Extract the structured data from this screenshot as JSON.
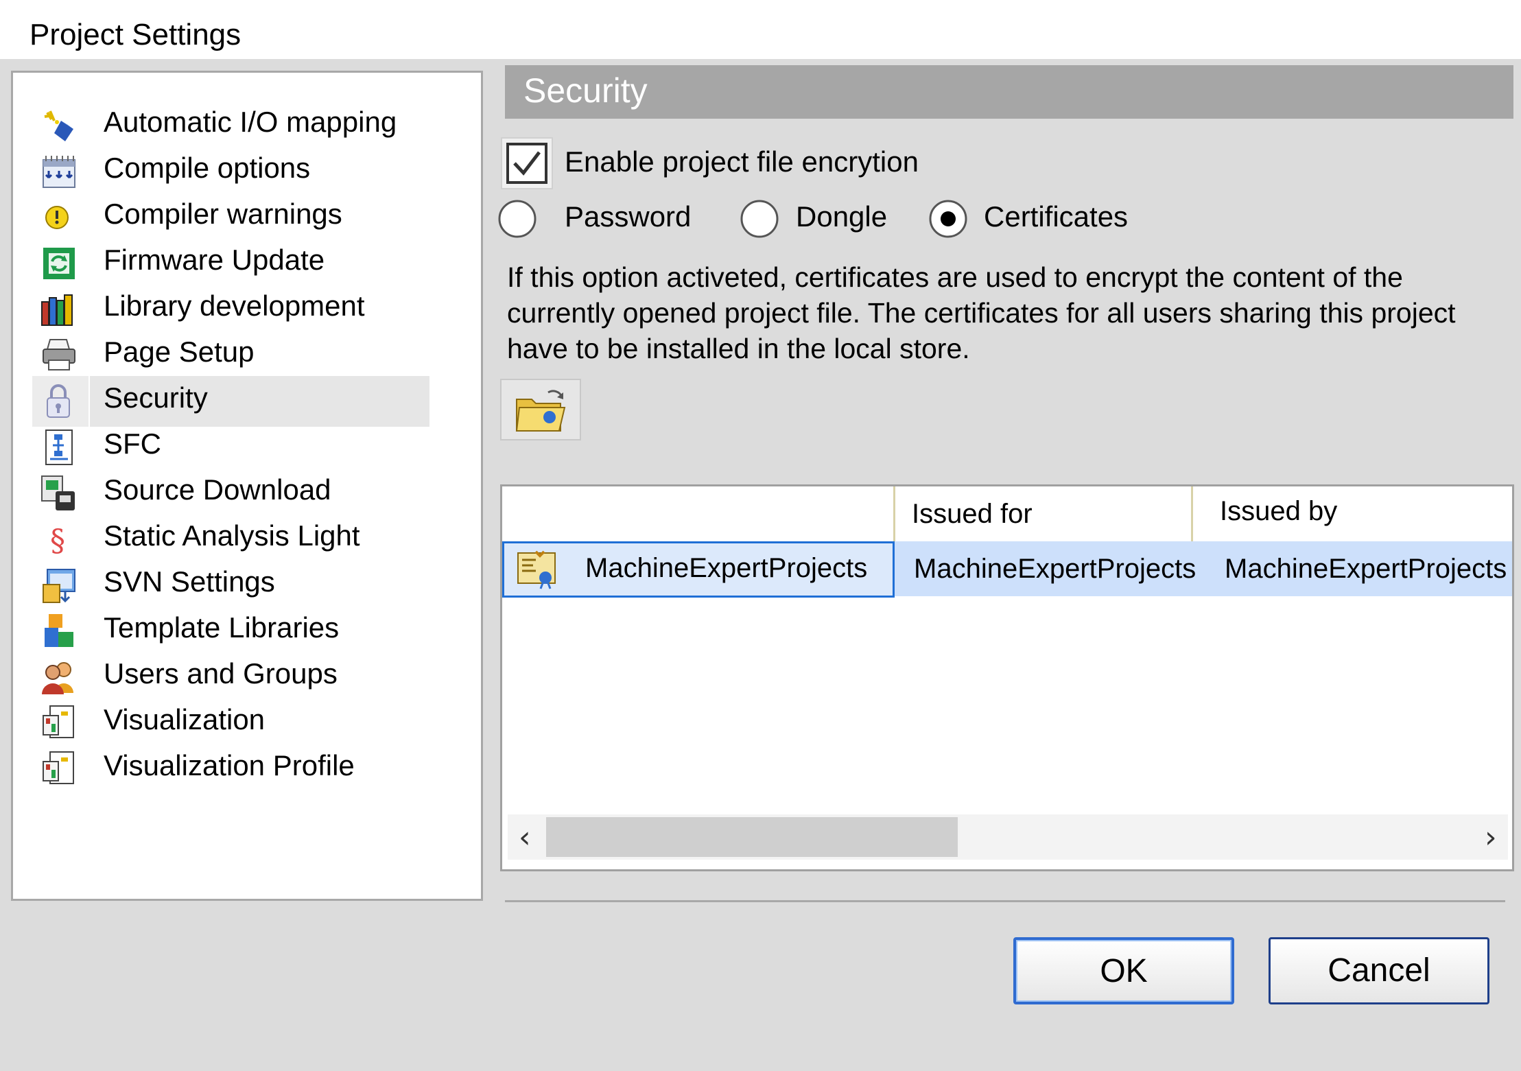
{
  "window": {
    "title": "Project Settings"
  },
  "sidebar": {
    "items": [
      {
        "label": "Automatic I/O mapping",
        "icon": "io-mapping-icon"
      },
      {
        "label": "Compile options",
        "icon": "compile-options-icon"
      },
      {
        "label": "Compiler warnings",
        "icon": "compiler-warnings-icon"
      },
      {
        "label": "Firmware Update",
        "icon": "firmware-update-icon"
      },
      {
        "label": "Library development",
        "icon": "library-development-icon"
      },
      {
        "label": "Page Setup",
        "icon": "printer-icon"
      },
      {
        "label": "Security",
        "icon": "lock-icon"
      },
      {
        "label": "SFC",
        "icon": "sfc-icon"
      },
      {
        "label": "Source Download",
        "icon": "source-download-icon"
      },
      {
        "label": "Static Analysis Light",
        "icon": "static-analysis-icon"
      },
      {
        "label": "SVN Settings",
        "icon": "svn-settings-icon"
      },
      {
        "label": "Template Libraries",
        "icon": "template-libraries-icon"
      },
      {
        "label": "Users and Groups",
        "icon": "users-groups-icon"
      },
      {
        "label": "Visualization",
        "icon": "visualization-icon"
      },
      {
        "label": "Visualization Profile",
        "icon": "visualization-profile-icon"
      }
    ],
    "selected": "Security"
  },
  "main": {
    "header": "Security",
    "encryption": {
      "label": "Enable project file encrytion",
      "checked": true
    },
    "methods": [
      {
        "label": "Password",
        "selected": false
      },
      {
        "label": "Dongle",
        "selected": false
      },
      {
        "label": "Certificates",
        "selected": true
      }
    ],
    "description": "If this option activeted, certificates are used to encrypt the content of the currently opened project file. The certificates for all users sharing this project have to be installed in the local store.",
    "table": {
      "columns": [
        "",
        "Issued for",
        "Issued by"
      ],
      "rows": [
        {
          "name": "MachineExpertProjects",
          "issued_for": "MachineExpertProjects",
          "issued_by": "MachineExpertProjects"
        }
      ],
      "scroll_left": "‹",
      "scroll_right": "›"
    }
  },
  "buttons": {
    "ok": "OK",
    "cancel": "Cancel"
  }
}
